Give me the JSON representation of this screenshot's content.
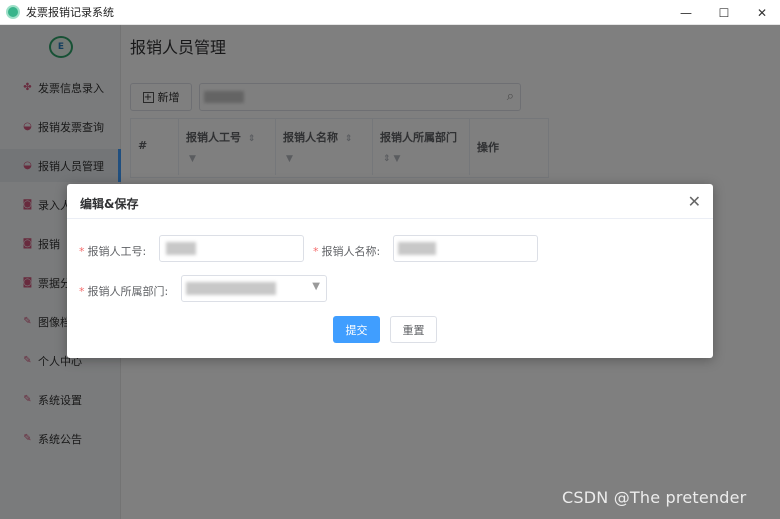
{
  "window": {
    "title": "发票报销记录系统",
    "minimize_icon": "—",
    "maximize_icon": "☐",
    "close_icon": "✕"
  },
  "sidebar": {
    "logo_text": "E",
    "items": [
      {
        "label": "发票信息录入",
        "icon": "pinwheel-icon",
        "active": false
      },
      {
        "label": "报销发票查询",
        "icon": "bowl-icon",
        "active": false
      },
      {
        "label": "报销人员管理",
        "icon": "bowl-icon",
        "active": true
      },
      {
        "label": "录入人",
        "icon": "camera-icon",
        "active": false
      },
      {
        "label": "报销",
        "icon": "camera-icon",
        "active": false
      },
      {
        "label": "票据分",
        "icon": "camera-icon",
        "active": false
      },
      {
        "label": "图像档",
        "icon": "brush-icon",
        "active": false
      },
      {
        "label": "个人中心",
        "icon": "brush-icon",
        "active": false
      },
      {
        "label": "系统设置",
        "icon": "brush-icon",
        "active": false
      },
      {
        "label": "系统公告",
        "icon": "brush-icon",
        "active": false
      }
    ]
  },
  "main": {
    "page_title": "报销人员管理",
    "add_button": "新增",
    "table": {
      "columns": [
        "#",
        "报销人工号",
        "报销人名称",
        "报销人所属部门",
        "操作"
      ]
    }
  },
  "dialog": {
    "title": "编辑&保存",
    "fields": {
      "employee_id_label": "报销人工号:",
      "name_label": "报销人名称:",
      "department_label": "报销人所属部门:"
    },
    "submit_label": "提交",
    "reset_label": "重置"
  },
  "watermark": "CSDN @The  pretender"
}
